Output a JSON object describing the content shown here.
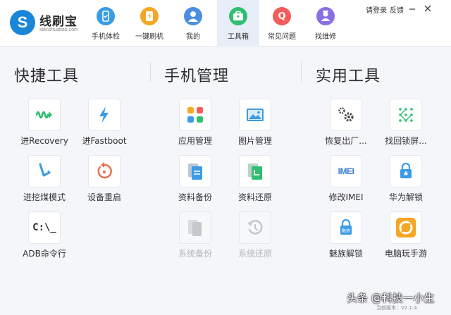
{
  "app": {
    "name": "线刷宝",
    "subtitle": "xianshuabao.com",
    "logo_letter": "S"
  },
  "nav": {
    "tabs": [
      {
        "label": "手机体检",
        "icon": "phone-check-icon",
        "color": "#3a9be6",
        "active": false
      },
      {
        "label": "一键刷机",
        "icon": "flash-icon",
        "color": "#f5a623",
        "active": false
      },
      {
        "label": "我的",
        "icon": "user-icon",
        "color": "#4a8fe0",
        "active": false
      },
      {
        "label": "工具箱",
        "icon": "toolbox-icon",
        "color": "#2fbf71",
        "active": true
      },
      {
        "label": "常见问题",
        "icon": "question-icon",
        "color": "#f25c5c",
        "active": false
      },
      {
        "label": "找维修",
        "icon": "repair-icon",
        "color": "#8a6ee6",
        "active": false
      }
    ]
  },
  "window": {
    "login": "请登录",
    "feedback": "反馈"
  },
  "sections": {
    "quick": {
      "title": "快捷工具",
      "tools": [
        {
          "label": "进Recovery",
          "icon": "recovery-icon"
        },
        {
          "label": "进Fastboot",
          "icon": "fastboot-icon"
        },
        {
          "label": "进挖煤模式",
          "icon": "download-mode-icon"
        },
        {
          "label": "设备重启",
          "icon": "reboot-icon"
        },
        {
          "label": "ADB命令行",
          "icon": "adb-terminal-icon",
          "text": "C:\\_"
        }
      ]
    },
    "manage": {
      "title": "手机管理",
      "tools": [
        {
          "label": "应用管理",
          "icon": "app-manage-icon"
        },
        {
          "label": "图片管理",
          "icon": "image-manage-icon"
        },
        {
          "label": "资料备份",
          "icon": "data-backup-icon"
        },
        {
          "label": "资料还原",
          "icon": "data-restore-icon"
        },
        {
          "label": "系统备份",
          "icon": "system-backup-icon",
          "disabled": true
        },
        {
          "label": "系统还原",
          "icon": "system-restore-icon",
          "disabled": true
        }
      ]
    },
    "practical": {
      "title": "实用工具",
      "tools": [
        {
          "label": "恢复出厂...",
          "icon": "factory-reset-icon"
        },
        {
          "label": "找回锁屏...",
          "icon": "unlock-pattern-icon"
        },
        {
          "label": "修改IMEI",
          "icon": "imei-icon",
          "text": "IMEI"
        },
        {
          "label": "华为解锁",
          "icon": "huawei-unlock-icon"
        },
        {
          "label": "魅族解锁",
          "icon": "meizu-unlock-icon",
          "text": "魅族"
        },
        {
          "label": "电脑玩手游",
          "icon": "mobile-game-icon"
        }
      ]
    }
  },
  "footer": {
    "version": "当前版本：V2.1.4",
    "watermark": "头条 @科技一小生"
  }
}
